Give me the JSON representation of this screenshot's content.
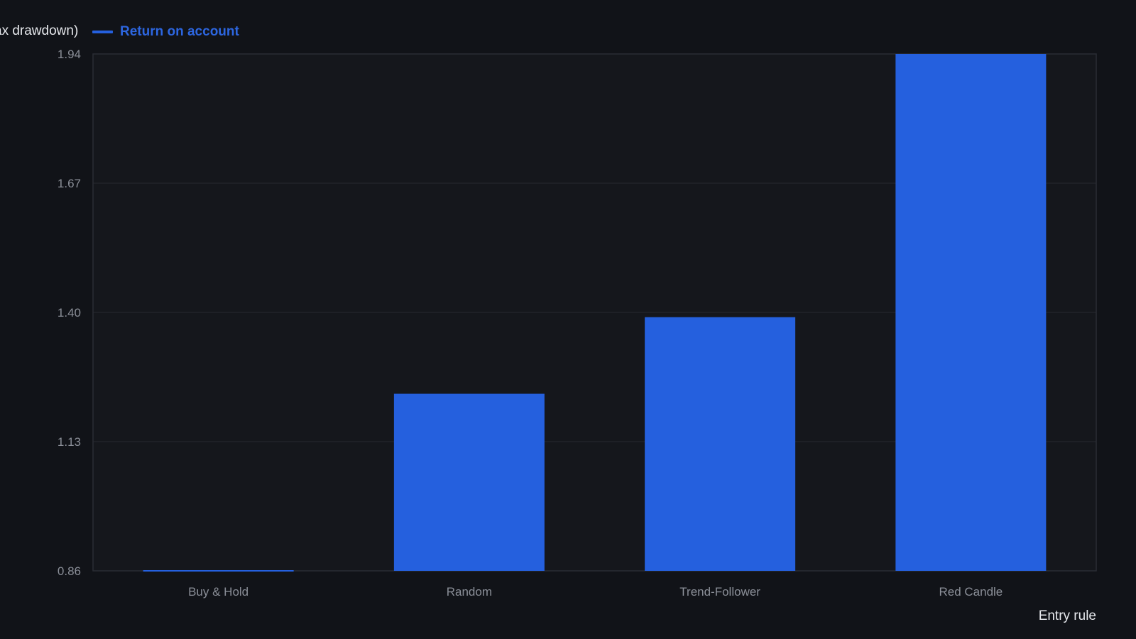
{
  "chart_data": {
    "type": "bar",
    "ylabel": "ax drawdown)",
    "xlabel": "Entry rule",
    "ylim": [
      0.86,
      1.94
    ],
    "yticks": [
      0.86,
      1.13,
      1.4,
      1.67,
      1.94
    ],
    "ytick_labels": [
      "0.86",
      "1.13",
      "1.40",
      "1.67",
      "1.94"
    ],
    "grid": true,
    "legend_placement": "top-left",
    "categories": [
      "Buy & Hold",
      "Random",
      "Trend-Follower",
      "Red Candle"
    ],
    "series": [
      {
        "name": "Return on account",
        "values": [
          0.86,
          1.23,
          1.39,
          1.94
        ]
      }
    ]
  },
  "colors": {
    "background": "#111318",
    "plot_background": "#15171c",
    "bar": "#2560de",
    "legend_text": "#2d66e0",
    "grid": "#262930",
    "tick_text": "#8b8f98",
    "label_text": "#e6e8ec"
  }
}
